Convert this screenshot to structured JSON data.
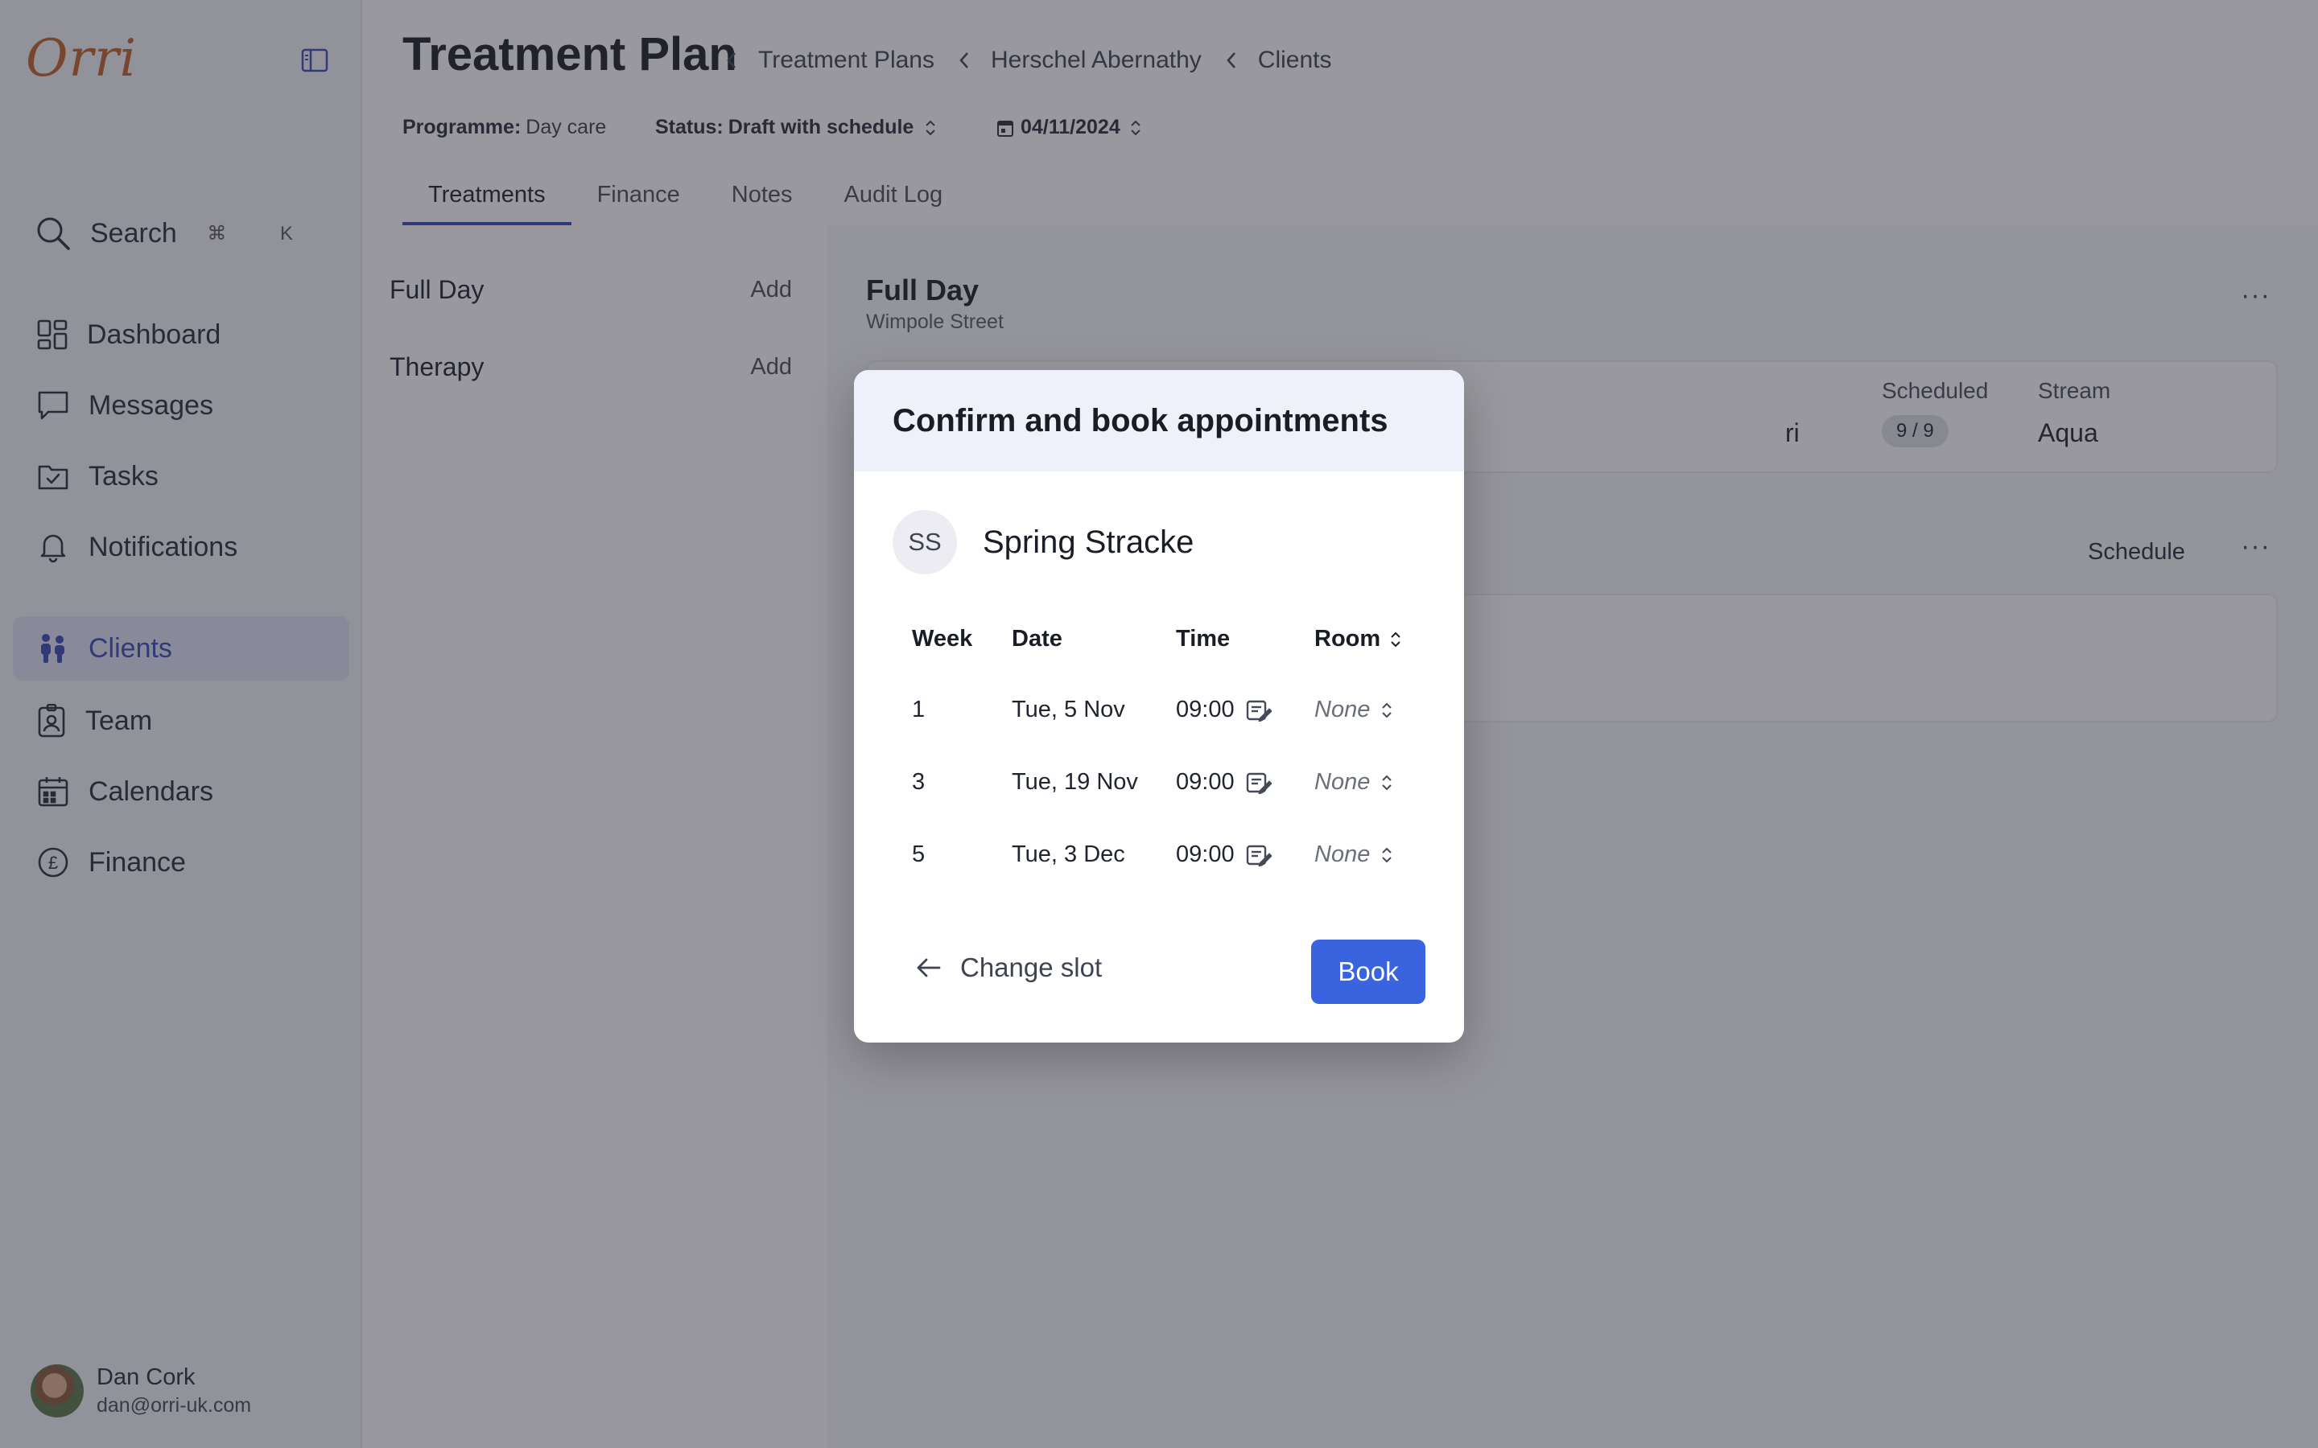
{
  "app": {
    "logo": "Orri",
    "search_label": "Search",
    "search_shortcut": "⌘ K",
    "accent_color": "#3b4bb5",
    "primary_button_color": "#3a63e0",
    "logo_color": "#c2632a"
  },
  "sidebar": {
    "items": [
      {
        "label": "Dashboard",
        "icon": "dashboard-icon"
      },
      {
        "label": "Messages",
        "icon": "messages-icon"
      },
      {
        "label": "Tasks",
        "icon": "tasks-icon"
      },
      {
        "label": "Notifications",
        "icon": "bell-icon"
      },
      {
        "label": "Clients",
        "icon": "clients-icon",
        "active": true
      },
      {
        "label": "Team",
        "icon": "team-badge-icon"
      },
      {
        "label": "Calendars",
        "icon": "calendar-icon"
      },
      {
        "label": "Finance",
        "icon": "pound-icon"
      }
    ],
    "user": {
      "name": "Dan Cork",
      "email": "dan@orri-uk.com"
    }
  },
  "header": {
    "title": "Treatment Plan",
    "breadcrumbs": [
      "Treatment Plans",
      "Herschel Abernathy",
      "Clients"
    ],
    "programme_label": "Programme:",
    "programme_value": "Day care",
    "status_label": "Status:",
    "status_value": "Draft with schedule",
    "date": "04/11/2024"
  },
  "tabs": [
    "Treatments",
    "Finance",
    "Notes",
    "Audit Log"
  ],
  "treatments": [
    {
      "name": "Full Day",
      "action": "Add"
    },
    {
      "name": "Therapy",
      "action": "Add"
    }
  ],
  "card": {
    "title": "Full Day",
    "subtitle": "Wimpole Street",
    "partial_value": "ri",
    "scheduled_label": "Scheduled",
    "scheduled_value": "9 / 9",
    "stream_label": "Stream",
    "stream_value": "Aqua",
    "schedule_button": "Schedule",
    "more": "···"
  },
  "modal": {
    "title": "Confirm and book appointments",
    "client_initials": "SS",
    "client_name": "Spring Stracke",
    "columns": [
      "Week",
      "Date",
      "Time",
      "Room"
    ],
    "rows": [
      {
        "week": "1",
        "date": "Tue, 5 Nov",
        "time": "09:00",
        "room": "None"
      },
      {
        "week": "3",
        "date": "Tue, 19 Nov",
        "time": "09:00",
        "room": "None"
      },
      {
        "week": "5",
        "date": "Tue, 3 Dec",
        "time": "09:00",
        "room": "None"
      }
    ],
    "change_slot": "Change slot",
    "book": "Book"
  }
}
